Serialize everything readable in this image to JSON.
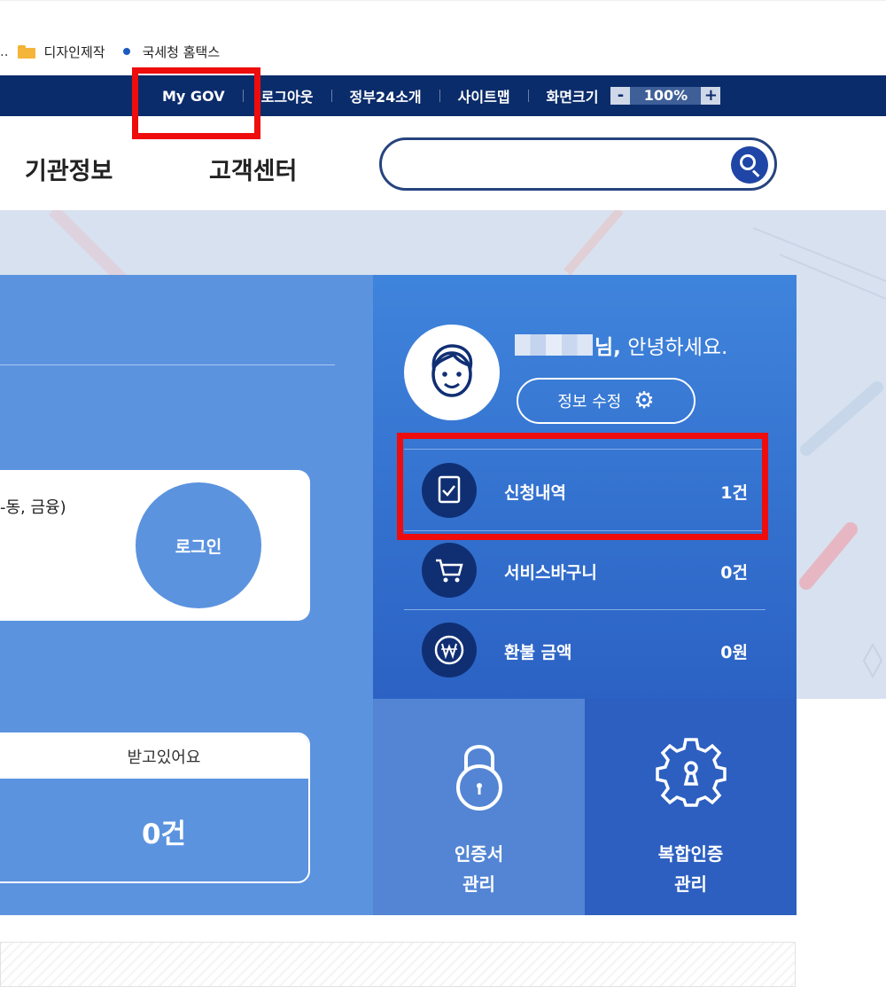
{
  "bookmarks": {
    "ellipsis": "..",
    "items": [
      {
        "label": "디자인제작",
        "icon": "folder-icon"
      },
      {
        "label": "국세청 홈택스",
        "icon": "dot-icon"
      }
    ]
  },
  "utility": {
    "items": [
      "My GOV",
      "로그아웃",
      "정부24소개",
      "사이트맵"
    ],
    "zoom_label": "화면크기",
    "zoom_minus": "-",
    "zoom_value": "100%",
    "zoom_plus": "+"
  },
  "nav": {
    "links": [
      "기관정보",
      "고객센터"
    ],
    "search": {
      "placeholder": ""
    }
  },
  "left": {
    "login_desc": "-동, 금융)",
    "login_button": "로그인",
    "count_header": "받고있어요",
    "count_value": "0건"
  },
  "profile": {
    "greeting_name_suffix": "님,",
    "greeting_text": " 안녕하세요.",
    "edit_button": "정보 수정"
  },
  "stats": [
    {
      "label": "신청내역",
      "value": "1건",
      "icon": "document-check-icon"
    },
    {
      "label": "서비스바구니",
      "value": "0건",
      "icon": "cart-icon"
    },
    {
      "label": "환불 금액",
      "value": "0원",
      "icon": "won-icon"
    }
  ],
  "tiles": [
    {
      "line1": "인증서",
      "line2": "관리",
      "icon": "lock-icon"
    },
    {
      "line1": "복합인증",
      "line2": "관리",
      "icon": "gear-lock-icon"
    }
  ],
  "colors": {
    "navy": "#0b2c6b",
    "panel_blue": "#5b93df",
    "highlight_red": "#ee0c0c"
  }
}
